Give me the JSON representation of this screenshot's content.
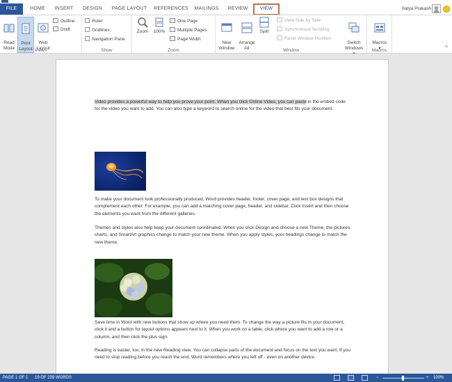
{
  "tabs": [
    {
      "label": "FILE"
    },
    {
      "label": "HOME"
    },
    {
      "label": "INSERT"
    },
    {
      "label": "DESIGN"
    },
    {
      "label": "PAGE LAYOUT"
    },
    {
      "label": "REFERENCES"
    },
    {
      "label": "MAILINGS"
    },
    {
      "label": "REVIEW"
    },
    {
      "label": "VIEW"
    }
  ],
  "user": {
    "name": "Satya Prakash"
  },
  "ribbon": {
    "views": {
      "label": "Views",
      "read_mode": "Read\nMode",
      "print_layout": "Print\nLayout",
      "web_layout": "Web\nLayout",
      "outline": "Outline",
      "draft": "Draft"
    },
    "show": {
      "label": "Show",
      "ruler": "Ruler",
      "gridlines": "Gridlines",
      "navigation_pane": "Navigation Pane"
    },
    "zoom": {
      "label": "Zoom",
      "zoom": "Zoom",
      "hundred": "100%",
      "one_page": "One Page",
      "multiple_pages": "Multiple Pages",
      "page_width": "Page Width"
    },
    "window": {
      "label": "Window",
      "new_window": "New\nWindow",
      "arrange_all": "Arrange\nAll",
      "split": "Split",
      "view_side_by_side": "View Side by Side",
      "sync_scrolling": "Synchronous Scrolling",
      "reset_window": "Reset Window Position",
      "switch_windows": "Switch\nWindows ▾"
    },
    "macros": {
      "label": "Macros",
      "macros": "Macros\n▾"
    }
  },
  "document": {
    "p1_highlight": "Video provides a powerful way to help you prove your point. When you click Online Video, you can paste",
    "p1_rest": "in the embed code for the video you want to add. You can also type a keyword to search online for the video that best fits your document.",
    "p2": "To make your document look professionally produced, Word provides header, footer, cover page, and text box designs that complement each other. For example, you can add a matching cover page, header, and sidebar. Click Insert and then choose the elements you want from the different galleries.",
    "p3": "Themes and styles also help keep your document coordinated. When you click Design and choose a new Theme, the pictures, charts, and SmartArt graphics change to match your new theme. When you apply styles, your headings change to match the new theme.",
    "p4": "Save time in Word with new buttons that show up where you need them. To change the way a picture fits in your document, click it and a button for layout options appears next to it. When you work on a table, click where you want to add a row or a column, and then click the plus sign.",
    "p5": "Reading is easier, too, in the new Reading view. You can collapse parts of the document and focus on the text you want. If you need to stop reading before you reach the end, Word remembers where you left off - even on another device."
  },
  "status": {
    "page": "PAGE 1 OF 1",
    "words": "19 OF 239 WORDS",
    "zoom_level": "100%"
  }
}
